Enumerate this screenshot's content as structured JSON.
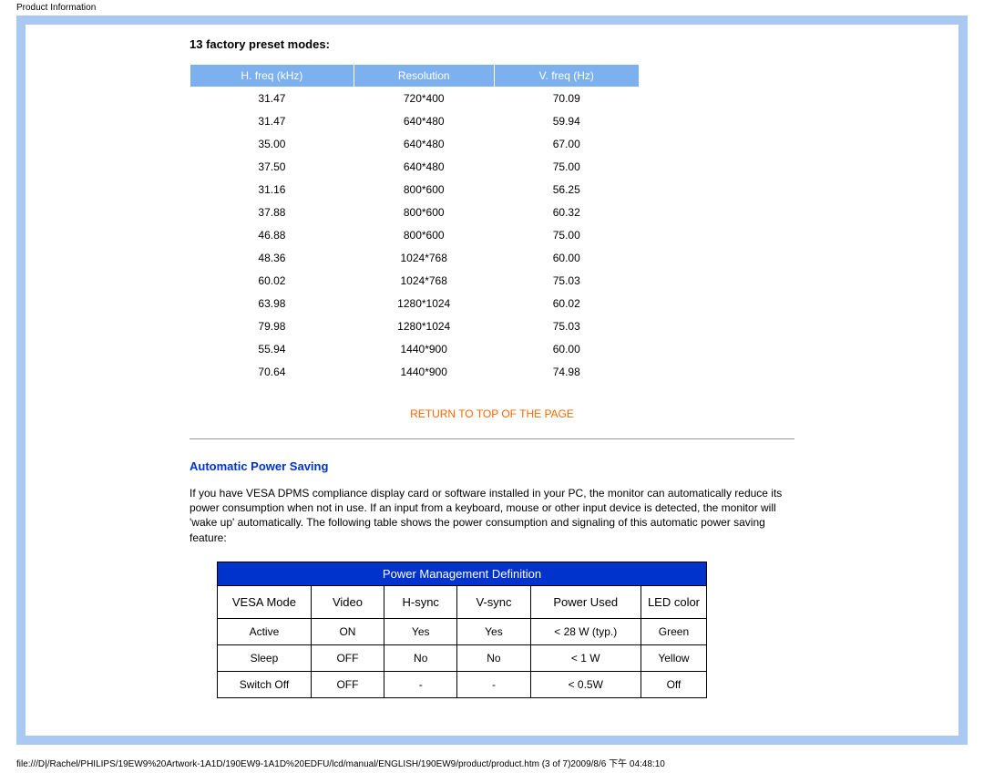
{
  "top_label": "Product Information",
  "preset_heading": "13 factory preset modes:",
  "preset_headers": {
    "h": "H. freq (kHz)",
    "r": "Resolution",
    "v": "V. freq (Hz)"
  },
  "preset_rows": [
    {
      "h": "31.47",
      "r": "720*400",
      "v": "70.09"
    },
    {
      "h": "31.47",
      "r": "640*480",
      "v": "59.94"
    },
    {
      "h": "35.00",
      "r": "640*480",
      "v": "67.00"
    },
    {
      "h": "37.50",
      "r": "640*480",
      "v": "75.00"
    },
    {
      "h": "31.16",
      "r": "800*600",
      "v": "56.25"
    },
    {
      "h": "37.88",
      "r": "800*600",
      "v": "60.32"
    },
    {
      "h": "46.88",
      "r": "800*600",
      "v": "75.00"
    },
    {
      "h": "48.36",
      "r": "1024*768",
      "v": "60.00"
    },
    {
      "h": "60.02",
      "r": "1024*768",
      "v": "75.03"
    },
    {
      "h": "63.98",
      "r": "1280*1024",
      "v": "60.02"
    },
    {
      "h": "79.98",
      "r": "1280*1024",
      "v": "75.03"
    },
    {
      "h": "55.94",
      "r": "1440*900",
      "v": "60.00"
    },
    {
      "h": "70.64",
      "r": "1440*900",
      "v": "74.98"
    }
  ],
  "return_link": "RETURN TO TOP OF THE PAGE",
  "aps_heading": "Automatic Power Saving",
  "aps_para": "If you have VESA DPMS compliance display card or software installed in your PC, the monitor can automatically reduce its power consumption when not in use. If an input from a keyboard, mouse or other input device is detected, the monitor will 'wake up' automatically. The following table shows the power consumption and signaling of this automatic power saving feature:",
  "pm_title": "Power Management Definition",
  "pm_headers": {
    "mode": "VESA Mode",
    "video": "Video",
    "hsync": "H-sync",
    "vsync": "V-sync",
    "power": "Power Used",
    "led": "LED color"
  },
  "pm_rows": [
    {
      "mode": "Active",
      "video": "ON",
      "hsync": "Yes",
      "vsync": "Yes",
      "power": "< 28 W (typ.)",
      "led": "Green"
    },
    {
      "mode": "Sleep",
      "video": "OFF",
      "hsync": "No",
      "vsync": "No",
      "power": "< 1 W",
      "led": "Yellow"
    },
    {
      "mode": "Switch Off",
      "video": "OFF",
      "hsync": "-",
      "vsync": "-",
      "power": "< 0.5W",
      "led": "Off"
    }
  ],
  "footer_path": "file:///D|/Rachel/PHILIPS/19EW9%20Artwork-1A1D/190EW9-1A1D%20EDFU/lcd/manual/ENGLISH/190EW9/product/product.htm (3 of 7)2009/8/6 下午 04:48:10"
}
